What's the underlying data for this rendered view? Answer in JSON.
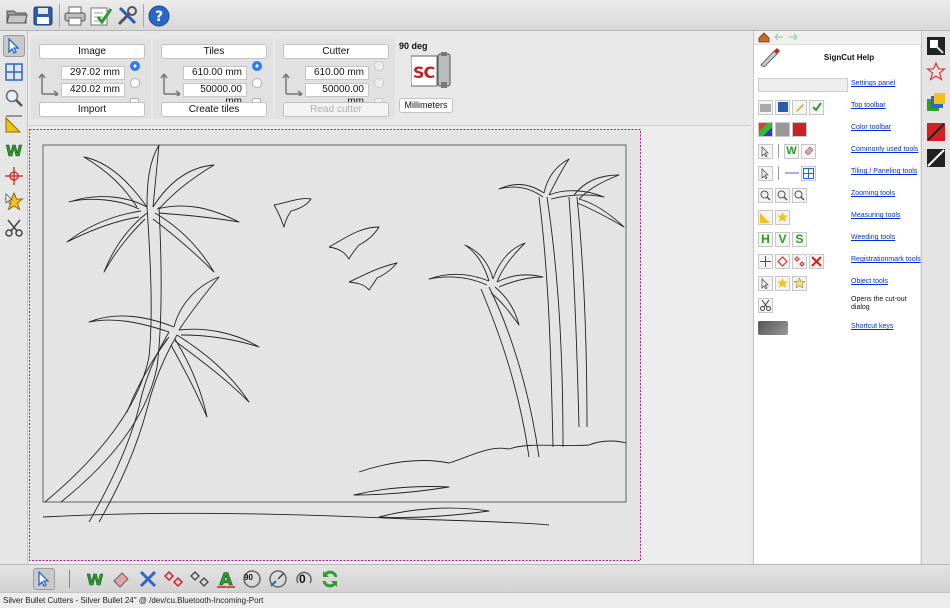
{
  "top_toolbar": {
    "buttons": [
      {
        "name": "open-file",
        "icon": "folder-icon"
      },
      {
        "name": "save-file",
        "icon": "floppy-disk-icon"
      },
      {
        "name": "print",
        "icon": "printer-icon"
      },
      {
        "name": "check-list",
        "icon": "checklist-icon"
      },
      {
        "name": "tools",
        "icon": "wrench-screwdriver-icon"
      },
      {
        "name": "help",
        "icon": "question-mark-icon"
      }
    ]
  },
  "settings_panel": {
    "image": {
      "title": "Image",
      "width_value": "297.02 mm",
      "height_value": "420.02 mm",
      "button": "Import"
    },
    "tiles": {
      "title": "Tiles",
      "width_value": "610.00 mm",
      "height_value": "50000.00 mm",
      "button": "Create tiles"
    },
    "cutter": {
      "title": "Cutter",
      "width_value": "610.00 mm",
      "height_value": "50000.00 mm",
      "button": "Read cutter"
    },
    "rotation_label": "90 deg",
    "logo_text": "SC",
    "units_button": "Millimeters"
  },
  "help_panel": {
    "title": "SignCut Help",
    "rows": [
      {
        "label": "Settings panel",
        "link": true
      },
      {
        "label": "Top toolbar",
        "link": true
      },
      {
        "label": "Color toolbar",
        "link": true
      },
      {
        "label": "Commonly used tools",
        "link": true
      },
      {
        "label": "Tiling / Paneling tools",
        "link": true
      },
      {
        "label": "Zooming tools",
        "link": true
      },
      {
        "label": "Measuring tools",
        "link": true
      },
      {
        "label": "Weeding tools",
        "link": true
      },
      {
        "label": "Registrationmark tools",
        "link": true
      },
      {
        "label": "Object tools",
        "link": true
      },
      {
        "label": "Opens the cut-out dialog",
        "link": false
      },
      {
        "label": "Shortcut keys",
        "link": true
      }
    ],
    "weeding_letters": [
      "H",
      "V",
      "S"
    ]
  },
  "bottom_toolbar": {
    "rotate_label": "90",
    "rotate_zero_label": "0"
  },
  "status_bar": {
    "text": "Silver Bullet Cutters - Silver Bullet 24\" @ /dev/cu.Bluetooth-Incoming-Port"
  },
  "colors": {
    "accent_blue": "#2c7bf0",
    "weed_green": "#2e9b2e",
    "reg_red": "#d32020",
    "selection_magenta": "#b0208c",
    "link_blue": "#0033cc"
  }
}
